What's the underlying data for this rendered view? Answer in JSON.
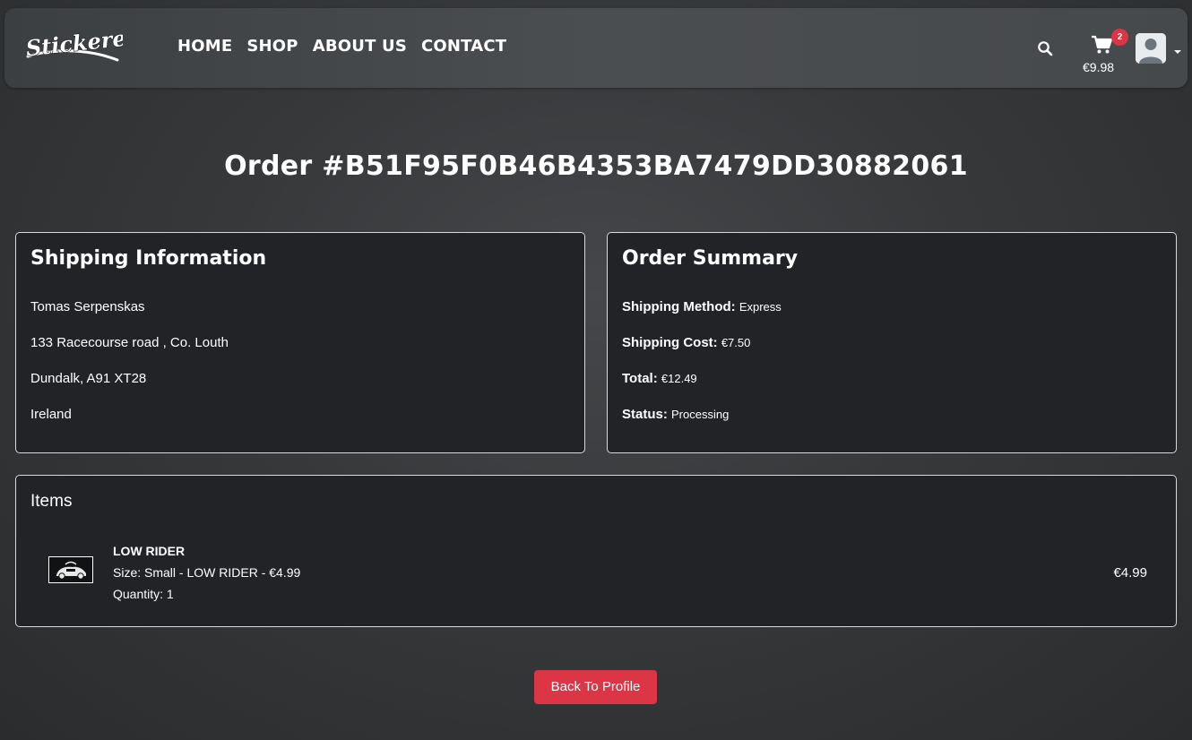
{
  "header": {
    "logo_text": "Stickered",
    "nav": [
      "HOME",
      "SHOP",
      "ABOUT US",
      "CONTACT"
    ],
    "cart": {
      "count": "2",
      "total": "€9.98"
    },
    "icons": {
      "search": "search-icon",
      "cart": "cart-icon",
      "user": "user-avatar-icon",
      "dropdown": "caret-down-icon"
    }
  },
  "page": {
    "title": "Order #B51F95F0B46B4353BA7479DD30882061"
  },
  "shipping": {
    "heading": "Shipping Information",
    "lines": [
      "Tomas Serpenskas",
      "133 Racecourse road , Co. Louth",
      "Dundalk, A91 XT28",
      "Ireland"
    ]
  },
  "summary": {
    "heading": "Order Summary",
    "rows": [
      {
        "label": "Shipping Method:",
        "value": "Express"
      },
      {
        "label": "Shipping Cost:",
        "value": "€7.50"
      },
      {
        "label": "Total:",
        "value": "€12.49"
      },
      {
        "label": "Status:",
        "value": "Processing"
      }
    ]
  },
  "items": {
    "heading": "Items",
    "list": [
      {
        "name": "LOW RIDER",
        "size": "Size: Small - LOW RIDER - €4.99",
        "quantity": "Quantity: 1",
        "price": "€4.99"
      }
    ]
  },
  "actions": {
    "back_label": "Back To Profile"
  },
  "colors": {
    "accent": "#dc3545",
    "card_bg": "#212327",
    "card_border": "#d7d9dc"
  }
}
